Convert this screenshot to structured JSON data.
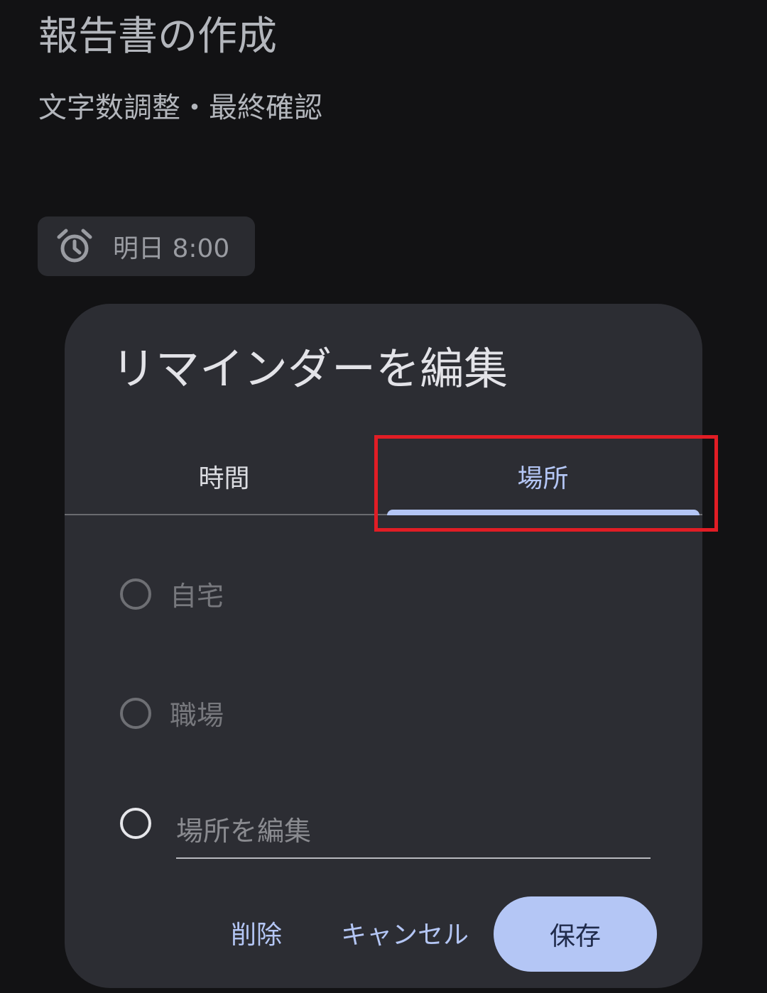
{
  "note": {
    "title": "報告書の作成",
    "body": "文字数調整・最終確認",
    "reminder_chip": {
      "icon": "alarm-clock-icon",
      "text": "明日 8:00"
    }
  },
  "dialog": {
    "title": "リマインダーを編集",
    "tabs": [
      {
        "label": "時間",
        "selected": false
      },
      {
        "label": "場所",
        "selected": true
      }
    ],
    "options": [
      {
        "label": "自宅",
        "enabled": false
      },
      {
        "label": "職場",
        "enabled": false
      }
    ],
    "place_input": {
      "value": "",
      "placeholder": "場所を編集"
    },
    "buttons": {
      "delete": "削除",
      "cancel": "キャンセル",
      "save": "保存"
    }
  },
  "colors": {
    "background": "#121214",
    "dialog": "#2c2d33",
    "accent": "#b4c6f5",
    "highlight": "#e11d25"
  }
}
